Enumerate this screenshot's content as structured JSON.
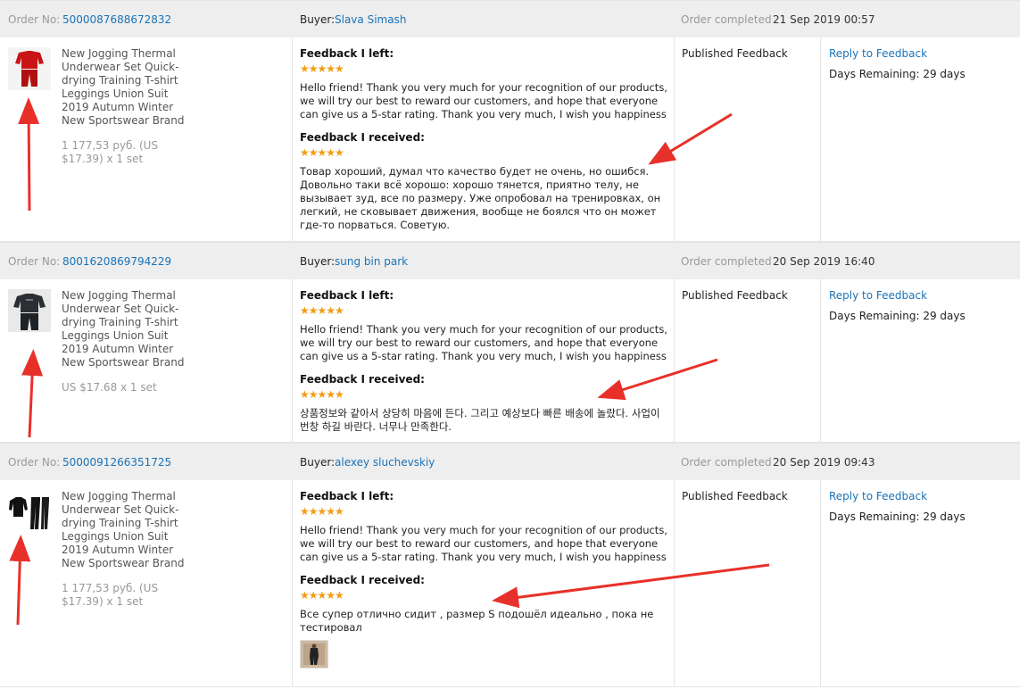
{
  "labels": {
    "order_no": "Order No:",
    "buyer": "Buyer:",
    "order_completed": "Order completed",
    "feedback_left": "Feedback I left:",
    "feedback_received": "Feedback I received:",
    "published": "Published Feedback",
    "reply": "Reply to Feedback",
    "days_remaining": "Days Remaining: 29 days",
    "stars": "★★★★★"
  },
  "colors": {
    "accent": "#1a73b8",
    "stars": "#f39c12",
    "arrow": "#e8302a",
    "header_bg": "#eeeeee"
  },
  "orders": [
    {
      "order_no": "5000087688672832",
      "buyer": "Slava Simash",
      "completed": "21 Sep 2019 00:57",
      "product_title": "New Jogging Thermal Underwear Set Quick-drying Training T-shirt Leggings Union Suit 2019 Autumn Winter New Sportswear Brand",
      "price": "1 177,53 руб. (US $17.39) x 1 set",
      "thumb_icon": "red-thermal-set-icon",
      "feedback_left_stars": 5,
      "feedback_left": "Hello friend! Thank you very much for your recognition of our products, we will try our best to reward our customers, and hope that everyone can give us a 5-star rating. Thank you very much, I wish you happiness",
      "feedback_received_stars": 5,
      "feedback_received": "Товар хороший, думал что качество будет не очень, но ошибся. Довольно таки всё хорошо: хорошо тянется, приятно телу, не вызывает зуд, все по размеру. Уже опробовал на тренировках, он легкий, не сковывает движения, вообще не боялся что он может где-то порваться. Советую."
    },
    {
      "order_no": "8001620869794229",
      "buyer": "sung bin park",
      "completed": "20 Sep 2019 16:40",
      "product_title": "New Jogging Thermal Underwear Set Quick-drying Training T-shirt Leggings Union Suit 2019 Autumn Winter New Sportswear Brand",
      "price": "US $17.68 x 1 set",
      "thumb_icon": "dark-thermal-set-icon",
      "feedback_left_stars": 5,
      "feedback_left": "Hello friend! Thank you very much for your recognition of our products, we will try our best to reward our customers, and hope that everyone can give us a 5-star rating. Thank you very much, I wish you happiness",
      "feedback_received_stars": 5,
      "feedback_received": "상품정보와 같아서 상당히 마음에 든다. 그리고 예상보다 빠른 배송에 놀랐다. 사업이 번창 하길 바란다. 너무나 만족한다."
    },
    {
      "order_no": "5000091266351725",
      "buyer": "alexey sluchevskiy",
      "completed": "20 Sep 2019 09:43",
      "product_title": "New Jogging Thermal Underwear Set Quick-drying Training T-shirt Leggings Union Suit 2019 Autumn Winter New Sportswear Brand",
      "price": "1 177,53 руб. (US $17.39) x 1 set",
      "thumb_icon": "black-thermal-set-icon",
      "feedback_left_stars": 5,
      "feedback_left": "Hello friend! Thank you very much for your recognition of our products, we will try our best to reward our customers, and hope that everyone can give us a 5-star rating. Thank you very much, I wish you happiness",
      "feedback_received_stars": 5,
      "feedback_received": "Все супер отлично сидит , размер S подошёл идеально , пока не тестировал",
      "photo_icon": "buyer-photo-icon"
    }
  ]
}
